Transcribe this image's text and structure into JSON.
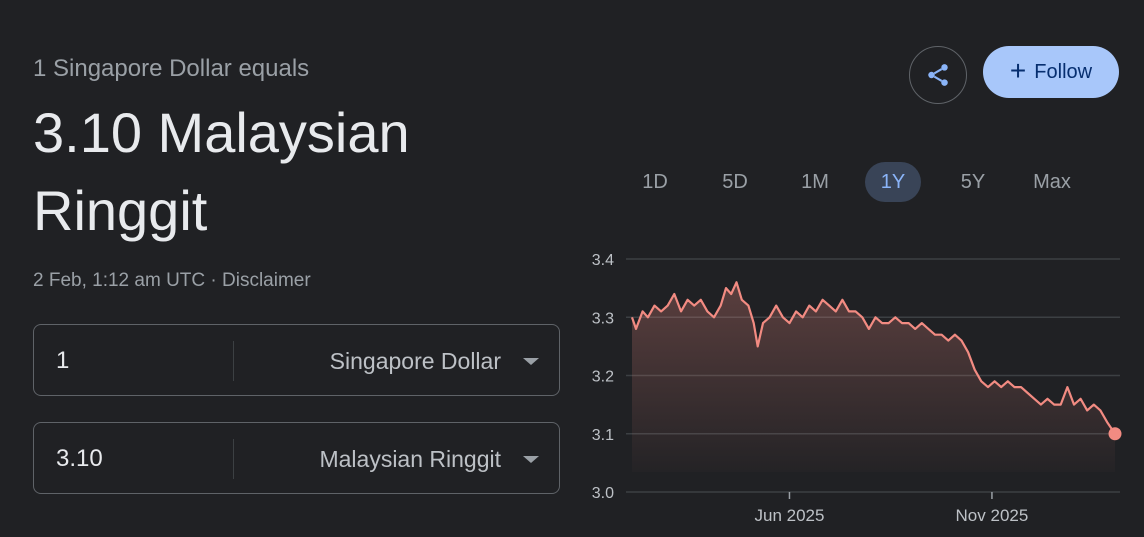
{
  "header": {
    "equals_text": "1 Singapore Dollar equals",
    "result_text": "3.10 Malaysian Ringgit",
    "timestamp": "2 Feb, 1:12 am UTC",
    "separator": " · ",
    "disclaimer": "Disclaimer"
  },
  "converter": {
    "from": {
      "amount": "1",
      "currency": "Singapore Dollar"
    },
    "to": {
      "amount": "3.10",
      "currency": "Malaysian Ringgit"
    }
  },
  "actions": {
    "follow_label": "Follow"
  },
  "ranges": [
    "1D",
    "5D",
    "1M",
    "1Y",
    "5Y",
    "Max"
  ],
  "active_range": "1Y",
  "colors": {
    "line": "#f28b82",
    "active_range_bg": "#394457",
    "active_range_text": "#8ab4f8",
    "follow_bg": "#a8c7fa"
  },
  "chart_data": {
    "type": "area",
    "title": "",
    "xlabel": "",
    "ylabel": "",
    "ylim": [
      3.0,
      3.4
    ],
    "yticks": [
      3.4,
      3.3,
      3.2,
      3.1,
      3.0
    ],
    "ytick_labels": [
      "3.4",
      "3.3",
      "3.2",
      "3.1",
      "3.0"
    ],
    "xlim": [
      "2025-02-02",
      "2026-02-02"
    ],
    "xticks": [
      {
        "date": "2025-06-01",
        "label": "Jun 2025"
      },
      {
        "date": "2025-11-01",
        "label": "Nov 2025"
      }
    ],
    "grid": true,
    "series": [
      {
        "points": [
          [
            "2025-02-02",
            3.3
          ],
          [
            "2025-02-05",
            3.28
          ],
          [
            "2025-02-10",
            3.31
          ],
          [
            "2025-02-14",
            3.3
          ],
          [
            "2025-02-19",
            3.32
          ],
          [
            "2025-02-24",
            3.31
          ],
          [
            "2025-03-01",
            3.32
          ],
          [
            "2025-03-06",
            3.34
          ],
          [
            "2025-03-11",
            3.31
          ],
          [
            "2025-03-16",
            3.33
          ],
          [
            "2025-03-21",
            3.32
          ],
          [
            "2025-03-26",
            3.33
          ],
          [
            "2025-03-31",
            3.31
          ],
          [
            "2025-04-05",
            3.3
          ],
          [
            "2025-04-10",
            3.32
          ],
          [
            "2025-04-14",
            3.35
          ],
          [
            "2025-04-18",
            3.34
          ],
          [
            "2025-04-22",
            3.36
          ],
          [
            "2025-04-26",
            3.33
          ],
          [
            "2025-05-01",
            3.32
          ],
          [
            "2025-05-05",
            3.29
          ],
          [
            "2025-05-08",
            3.25
          ],
          [
            "2025-05-12",
            3.29
          ],
          [
            "2025-05-17",
            3.3
          ],
          [
            "2025-05-22",
            3.32
          ],
          [
            "2025-05-27",
            3.3
          ],
          [
            "2025-06-01",
            3.29
          ],
          [
            "2025-06-06",
            3.31
          ],
          [
            "2025-06-11",
            3.3
          ],
          [
            "2025-06-16",
            3.32
          ],
          [
            "2025-06-21",
            3.31
          ],
          [
            "2025-06-26",
            3.33
          ],
          [
            "2025-07-01",
            3.32
          ],
          [
            "2025-07-06",
            3.31
          ],
          [
            "2025-07-11",
            3.33
          ],
          [
            "2025-07-16",
            3.31
          ],
          [
            "2025-07-21",
            3.31
          ],
          [
            "2025-07-26",
            3.3
          ],
          [
            "2025-07-31",
            3.28
          ],
          [
            "2025-08-05",
            3.3
          ],
          [
            "2025-08-10",
            3.29
          ],
          [
            "2025-08-15",
            3.29
          ],
          [
            "2025-08-20",
            3.3
          ],
          [
            "2025-08-25",
            3.29
          ],
          [
            "2025-08-30",
            3.29
          ],
          [
            "2025-09-04",
            3.28
          ],
          [
            "2025-09-09",
            3.29
          ],
          [
            "2025-09-14",
            3.28
          ],
          [
            "2025-09-19",
            3.27
          ],
          [
            "2025-09-24",
            3.27
          ],
          [
            "2025-09-29",
            3.26
          ],
          [
            "2025-10-04",
            3.27
          ],
          [
            "2025-10-09",
            3.26
          ],
          [
            "2025-10-14",
            3.24
          ],
          [
            "2025-10-19",
            3.21
          ],
          [
            "2025-10-24",
            3.19
          ],
          [
            "2025-10-29",
            3.18
          ],
          [
            "2025-11-03",
            3.19
          ],
          [
            "2025-11-08",
            3.18
          ],
          [
            "2025-11-13",
            3.19
          ],
          [
            "2025-11-18",
            3.18
          ],
          [
            "2025-11-23",
            3.18
          ],
          [
            "2025-11-28",
            3.17
          ],
          [
            "2025-12-03",
            3.16
          ],
          [
            "2025-12-08",
            3.15
          ],
          [
            "2025-12-13",
            3.16
          ],
          [
            "2025-12-18",
            3.15
          ],
          [
            "2025-12-23",
            3.15
          ],
          [
            "2025-12-28",
            3.18
          ],
          [
            "2026-01-02",
            3.15
          ],
          [
            "2026-01-07",
            3.16
          ],
          [
            "2026-01-12",
            3.14
          ],
          [
            "2026-01-17",
            3.15
          ],
          [
            "2026-01-22",
            3.14
          ],
          [
            "2026-01-27",
            3.12
          ],
          [
            "2026-02-02",
            3.1
          ]
        ]
      }
    ]
  }
}
